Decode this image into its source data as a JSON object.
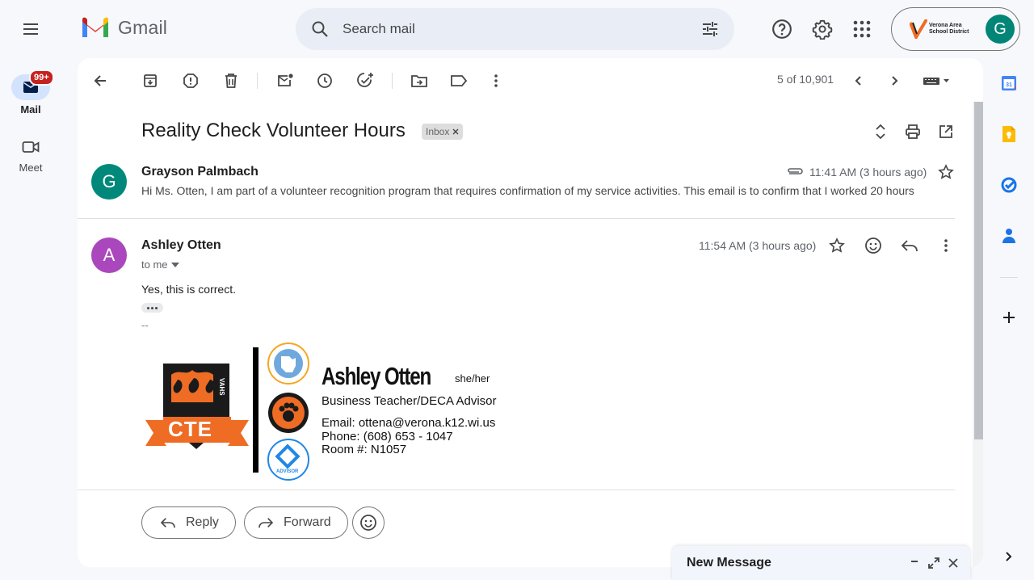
{
  "app": {
    "name": "Gmail"
  },
  "search": {
    "placeholder": "Search mail"
  },
  "account": {
    "org_name": "Verona Area School District",
    "avatar_letter": "G"
  },
  "left_nav": {
    "mail_label": "Mail",
    "mail_badge": "99+",
    "meet_label": "Meet"
  },
  "toolbar": {
    "counter": "5 of 10,901"
  },
  "thread": {
    "subject": "Reality Check Volunteer Hours",
    "label_chip": "Inbox",
    "messages": [
      {
        "avatar_letter": "G",
        "avatar_color": "#00897b",
        "sender": "Grayson Palmbach",
        "time": "11:41 AM (3 hours ago)",
        "snippet": "Hi Ms. Otten, I am part of a volunteer recognition program that requires confirmation of my service activities. This email is to confirm that I worked 20 hours"
      },
      {
        "avatar_letter": "A",
        "avatar_color": "#ab47bc",
        "sender": "Ashley Otten",
        "time": "11:54 AM (3 hours ago)",
        "to": "to me",
        "body": "Yes, this is correct.",
        "sig_separator": "--"
      }
    ]
  },
  "signature": {
    "name": "Ashley Otten",
    "pronouns": "she/her",
    "title": "Business Teacher/DECA Advisor",
    "email": "Email: ottena@verona.k12.wi.us",
    "phone": "Phone: (608) 653 - 1047",
    "room": "Room #: N1057",
    "badge_text": "CTE",
    "badge_side_text": "VAHS",
    "advisor_text": "ADVISOR"
  },
  "actions": {
    "reply": "Reply",
    "forward": "Forward"
  },
  "compose": {
    "title": "New Message"
  },
  "colors": {
    "accent": "#0b57d0",
    "badge_red": "#c5221f",
    "orange": "#ef6c24"
  }
}
